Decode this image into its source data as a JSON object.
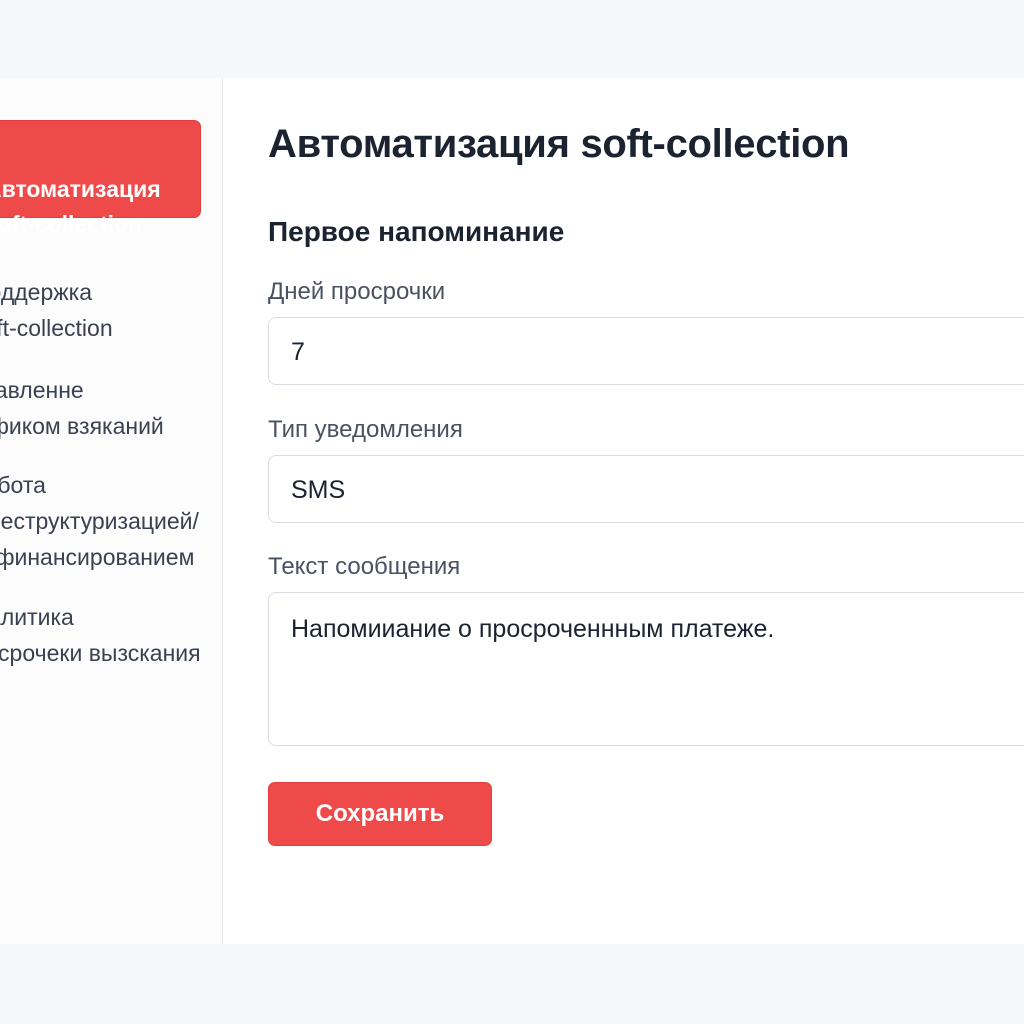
{
  "sidebar": {
    "active_item": "Автоматизация\nsoft-collection",
    "items": [
      {
        "label": "Поддержка\nsoft-collection"
      },
      {
        "label": "Управленне\nграфиком взяканий"
      },
      {
        "label": "Работа\nс реструктуризацией/\nрефинансированием"
      },
      {
        "label": "Аналитика\nпросрочеки вызскания"
      }
    ]
  },
  "main": {
    "title": "Автоматизация soft-collection",
    "section_title": "Первое напоминание",
    "days_label": "Дней просрочки",
    "days_value": "7",
    "type_label": "Тип уведомления",
    "type_value": "SMS",
    "message_label": "Текст сообщения",
    "message_value": "Напомииание о просроченнным платеже.",
    "save_label": "Сохранить"
  },
  "colors": {
    "accent": "#ef4a4a",
    "background": "#f6f7f9",
    "panel": "#ffffff",
    "text": "#1b2230"
  }
}
